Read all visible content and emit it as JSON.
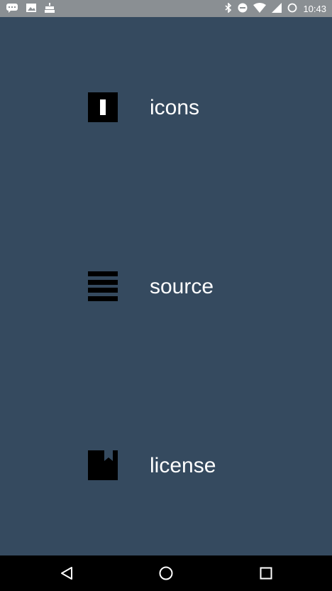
{
  "status_bar": {
    "time": "10:43",
    "left_icons": [
      "notification-icon",
      "image-icon",
      "cake-icon"
    ],
    "right_icons": [
      "bluetooth-icon",
      "do-not-disturb-icon",
      "wifi-icon",
      "signal-icon",
      "battery-icon"
    ]
  },
  "menu": {
    "items": [
      {
        "label": "icons",
        "icon": "icon-set-icon"
      },
      {
        "label": "source",
        "icon": "menu-lines-icon"
      },
      {
        "label": "license",
        "icon": "bookmark-icon"
      }
    ]
  },
  "colors": {
    "background": "#354A5F",
    "status_bar": "#8A8F93",
    "text": "#FFFFFF",
    "nav_bar": "#000000"
  },
  "nav_bar": {
    "buttons": [
      "back-icon",
      "home-icon",
      "recents-icon"
    ]
  }
}
